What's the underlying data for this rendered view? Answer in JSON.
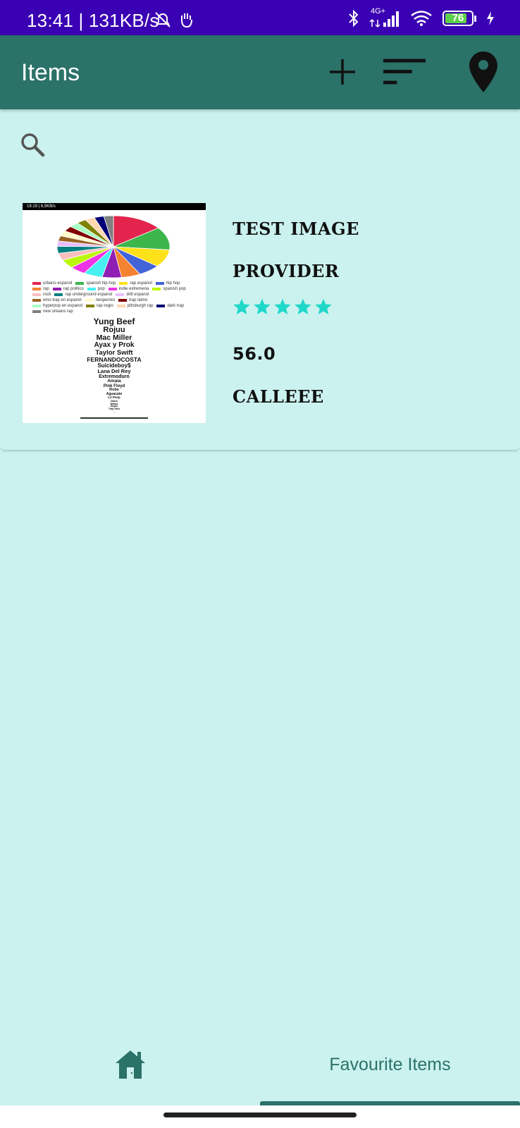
{
  "status_bar": {
    "time": "13:41 | 131KB/s",
    "network": "4G+",
    "battery": "76"
  },
  "app_bar": {
    "title": "Items",
    "actions": [
      "add-icon",
      "sort-icon",
      "location-pin-icon"
    ]
  },
  "search": {
    "placeholder": "",
    "value": ""
  },
  "item": {
    "title": "TEST IMAGE",
    "provider": "PROVIDER",
    "rating": 5,
    "rating_max": 5,
    "price": "56.0",
    "location": "CALLEEE",
    "thumbnail": {
      "status_text": "18:19 | 6,9KB/s",
      "legend": [
        {
          "label": "urbano espanol",
          "color": "#e3254d"
        },
        {
          "label": "spanish hip hop",
          "color": "#3cb64a"
        },
        {
          "label": "rap espanol",
          "color": "#ffe119"
        },
        {
          "label": "hip hop",
          "color": "#4363d8"
        },
        {
          "label": "rap",
          "color": "#f58231"
        },
        {
          "label": "rap politico",
          "color": "#911eb4"
        },
        {
          "label": "pop",
          "color": "#46f0f0"
        },
        {
          "label": "indie extremena",
          "color": "#f032e6"
        },
        {
          "label": "spanish pop",
          "color": "#bcf60c"
        },
        {
          "label": "rock",
          "color": "#fabebe"
        },
        {
          "label": "rap underground espanol",
          "color": "#008080"
        },
        {
          "label": "drill espanol",
          "color": "#e6beff"
        },
        {
          "label": "emo trap en espanol",
          "color": "#9a6324"
        },
        {
          "label": "neoperreo",
          "color": "#fffac8"
        },
        {
          "label": "trap latino",
          "color": "#800000"
        },
        {
          "label": "hyperpop en espanol",
          "color": "#aaffc3"
        },
        {
          "label": "rap regio",
          "color": "#808000"
        },
        {
          "label": "pittsburgh rap",
          "color": "#ffd8b1"
        },
        {
          "label": "dark trap",
          "color": "#000075"
        },
        {
          "label": "new orleans rap",
          "color": "#808080"
        }
      ],
      "artists": [
        "Yung Beef",
        "Rojuu",
        "Mac Miller",
        "Ayax y Prok",
        "Taylor Swift",
        "FERNANDOCOSTA",
        "Suicideboy$",
        "Lana Del Rey",
        "Extremoduro",
        "Amaia",
        "Pink Floyd",
        "Robe",
        "Aguacate",
        "Lil Peep",
        "Dano",
        "Natos",
        "Kaydy",
        "Trap Vaes",
        "..."
      ]
    }
  },
  "bottom_nav": {
    "home_icon": "home-icon",
    "favourites_label": "Favourite Items"
  },
  "colors": {
    "status_bar": "#3a00b3",
    "app_bar": "#2b7269",
    "background": "#cbf2ef",
    "star": "#1fd8c9"
  }
}
